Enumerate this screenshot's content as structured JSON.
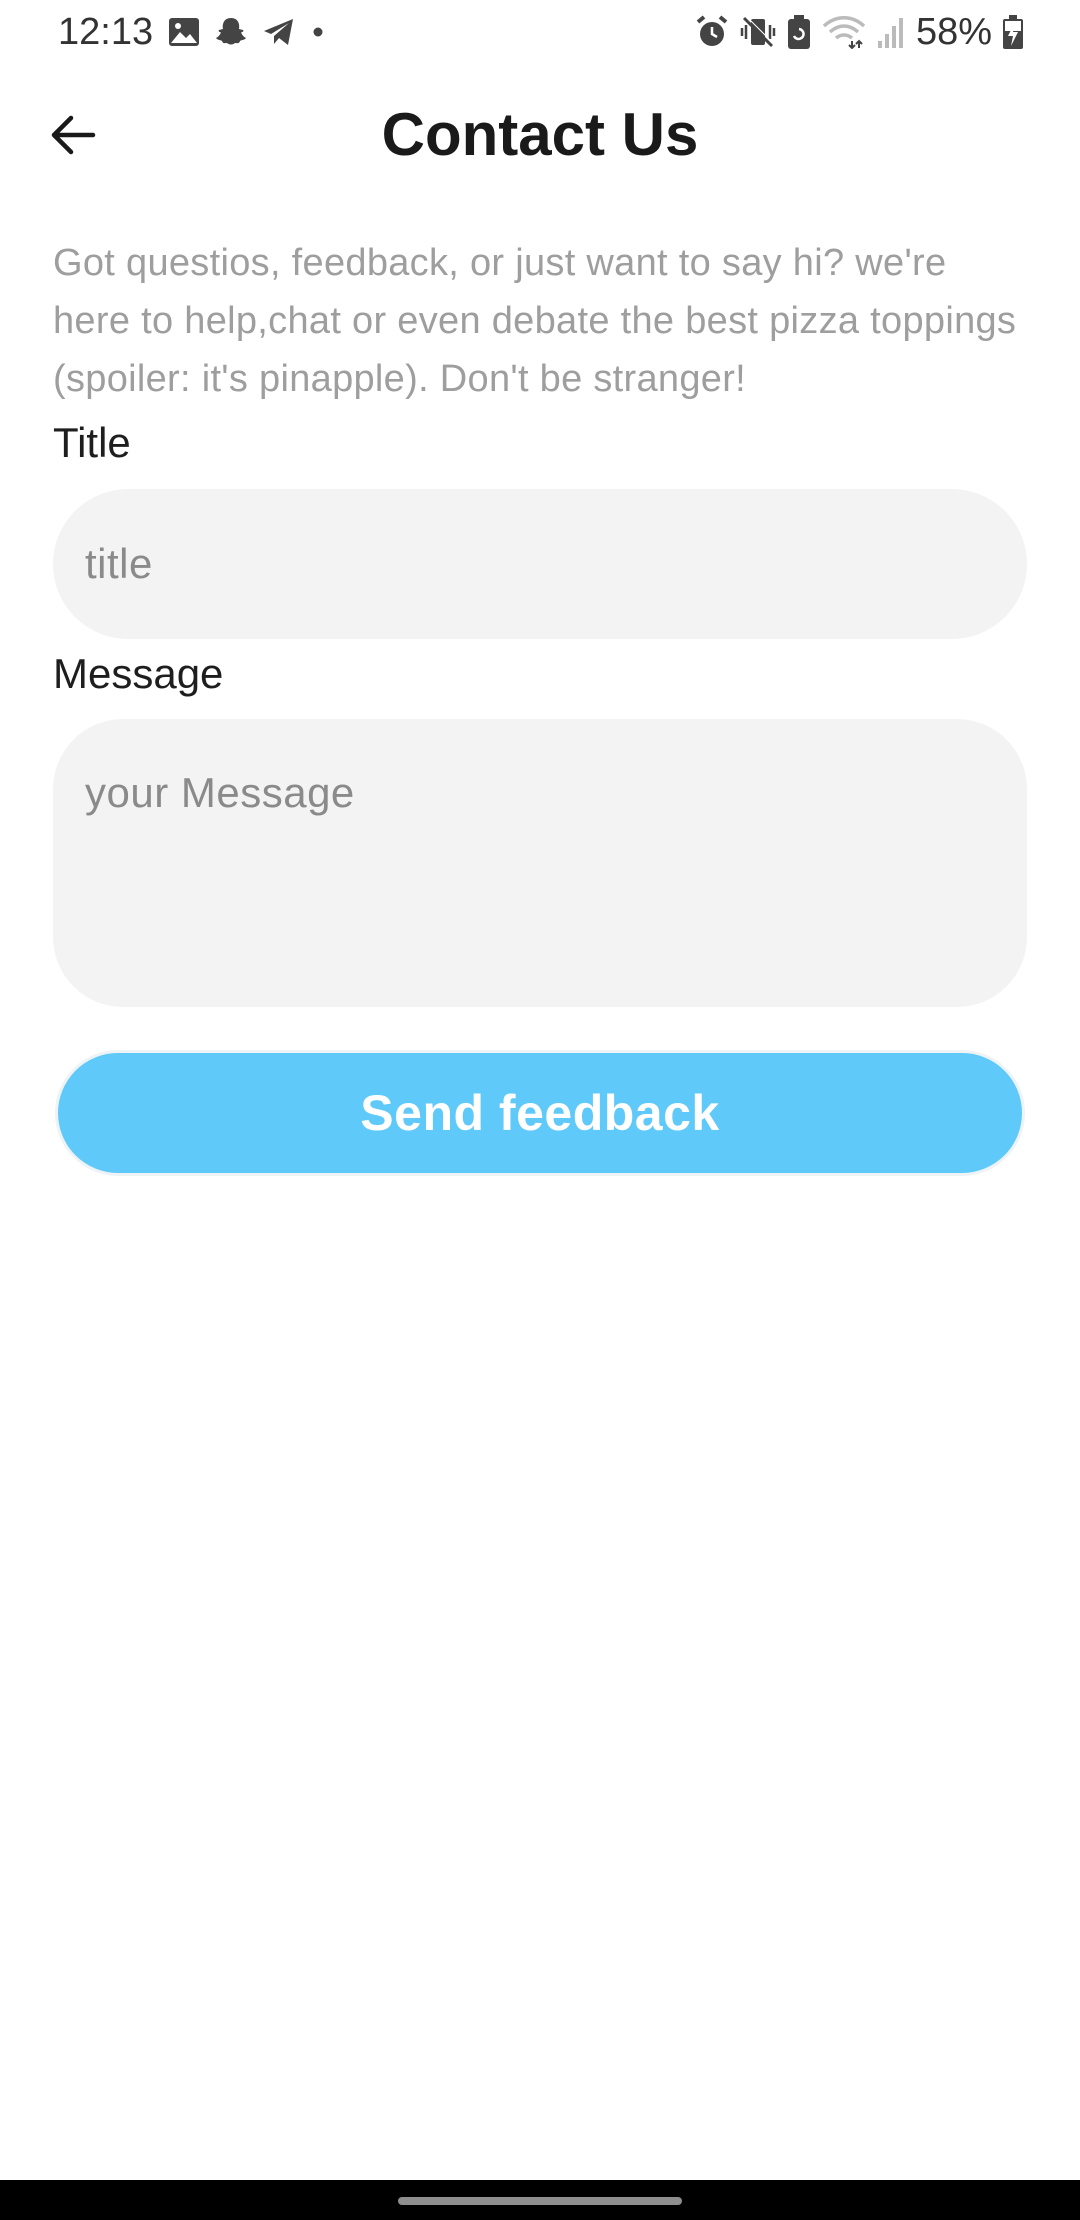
{
  "status_bar": {
    "time": "12:13",
    "battery_percent": "58%",
    "left_icons": [
      "gallery-icon",
      "snapchat-icon",
      "telegram-icon",
      "dot-icon"
    ],
    "right_icons": [
      "alarm-icon",
      "vibrate-mute-icon",
      "battery-saver-icon",
      "wifi-icon",
      "signal-icon",
      "battery-charging-icon"
    ]
  },
  "app_bar": {
    "title": "Contact Us",
    "back_icon": "arrow-left-icon"
  },
  "intro": {
    "text": "Got questios, feedback, or just want to say hi? we're here to help,chat or even debate the best pizza toppings (spoiler: it's pinapple). Don't be stranger!"
  },
  "form": {
    "title_label": "Title",
    "title_value": "",
    "title_placeholder": "title",
    "message_label": "Message",
    "message_value": "",
    "message_placeholder": "your Message",
    "submit_label": "Send feedback"
  },
  "colors": {
    "accent": "#5fc9fa",
    "input_background": "#f3f3f3",
    "intro_text": "#9e9e9e",
    "title_text": "#1a1a1a"
  }
}
